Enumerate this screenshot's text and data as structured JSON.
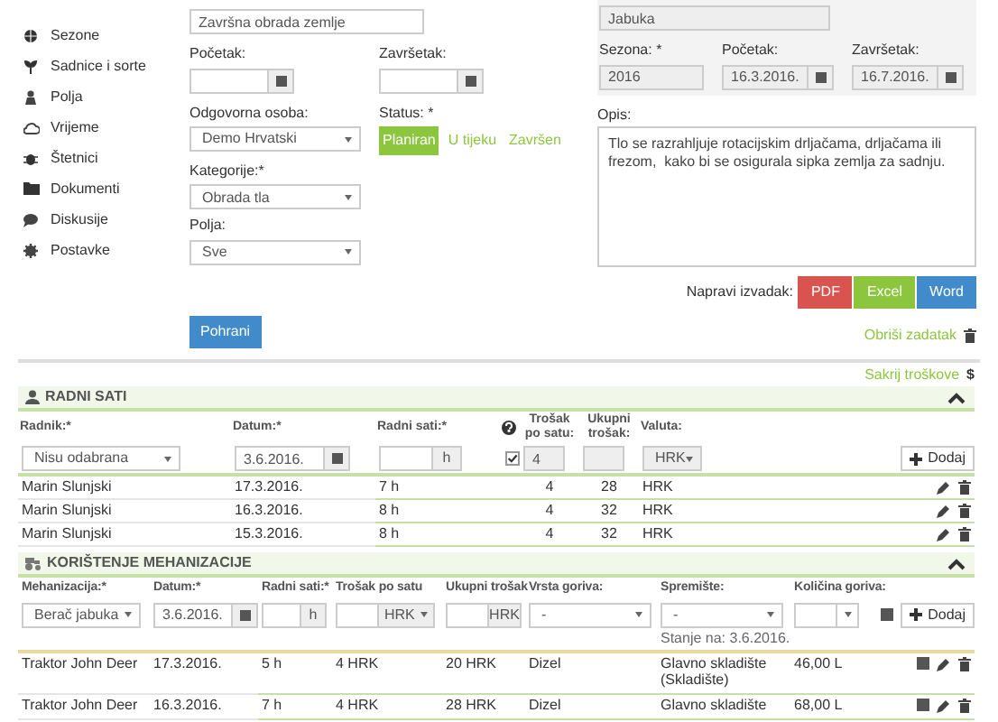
{
  "sidebar": {
    "items": [
      {
        "label": "Sezone",
        "kind": "globe"
      },
      {
        "label": "Sadnice i sorte",
        "kind": "plant"
      },
      {
        "label": "Polja",
        "kind": "person"
      },
      {
        "label": "Vrijeme",
        "kind": "cloud"
      },
      {
        "label": "Štetnici",
        "kind": "bug"
      },
      {
        "label": "Dokumenti",
        "kind": "folder"
      },
      {
        "label": "Diskusije",
        "kind": "chat"
      },
      {
        "label": "Postavke",
        "kind": "gear"
      }
    ]
  },
  "task_form": {
    "name_value": "Završna obrada zemlje",
    "start_label": "Početak:",
    "end_label": "Završetak:",
    "person_label": "Odgovorna osoba:",
    "person_value": "Demo Hrvatski",
    "status_label": "Status: *",
    "statuses": [
      {
        "label": "Planiran",
        "selected": true
      },
      {
        "label": "U tijeku",
        "selected": false
      },
      {
        "label": "Završen",
        "selected": false
      }
    ],
    "category_label": "Kategorije:*",
    "category_value": "Obrada tla",
    "fields_label": "Polja:",
    "fields_value": "Sve",
    "save_button": "Pohrani"
  },
  "culture_panel": {
    "culture_value": "Jabuka",
    "season_label": "Sezona: *",
    "season_value": "2016",
    "start_label": "Početak:",
    "start_value": "16.3.2016.",
    "end_label": "Završetak:",
    "end_value": "16.7.2016.",
    "description_label": "Opis:",
    "description_value": "Tlo se razrahljuje rotacijskim drljačama, drljačama ili frezom,  kako bi se osigurala sipka zemlja za sadnju.",
    "export_label": "Napravi izvadak:",
    "export_buttons": [
      {
        "label": "PDF",
        "color": "#d9534f"
      },
      {
        "label": "Excel",
        "color": "#8cc63f"
      },
      {
        "label": "Word",
        "color": "#428bca"
      }
    ],
    "delete_link": "Obriši zadatak"
  },
  "costs_toggle": {
    "label": "Sakrij troškove",
    "icon": "$"
  },
  "work_hours": {
    "title": "RADNI SATI",
    "columns": [
      "Radnik:*",
      "Datum:*",
      "Radni sati:*",
      "Trošak po satu:",
      "Ukupni trošak:",
      "Valuta:"
    ],
    "new_row": {
      "worker": "Nisu odabrana",
      "date": "3.6.2016.",
      "hours_unit": "h",
      "checked": true,
      "rate": "4",
      "currency": "HRK",
      "add_button": "Dodaj"
    },
    "rows": [
      {
        "worker": "Marin Slunjski",
        "date": "17.3.2016.",
        "hours": "7 h",
        "rate": "4",
        "total": "28",
        "currency": "HRK"
      },
      {
        "worker": "Marin Slunjski",
        "date": "16.3.2016.",
        "hours": "8 h",
        "rate": "4",
        "total": "32",
        "currency": "HRK"
      },
      {
        "worker": "Marin Slunjski",
        "date": "15.3.2016.",
        "hours": "8 h",
        "rate": "4",
        "total": "32",
        "currency": "HRK"
      }
    ]
  },
  "machinery": {
    "title": "KORIŠTENJE MEHANIZACIJE",
    "columns": [
      "Mehanizacija:*",
      "Datum:*",
      "Radni sati:*",
      "Trošak po satu",
      "Ukupni trošak",
      "Vrsta goriva:",
      "Spremište:",
      "Količina goriva:"
    ],
    "new_row": {
      "machine": "Berač jabuka",
      "date": "3.6.2016.",
      "hours_unit": "h",
      "rate_currency": "HRK",
      "total_currency": "HRK",
      "fuel": "-",
      "storage": "-",
      "storage_note": "Stanje na: 3.6.2016.",
      "add_button": "Dodaj"
    },
    "rows": [
      {
        "machine": "Traktor John Deer",
        "date": "17.3.2016.",
        "hours": "5 h",
        "rate": "4 HRK",
        "total": "20 HRK",
        "fuel": "Dizel",
        "storage": "Glavno skladište (Skladište)",
        "amount": "46,00 L"
      },
      {
        "machine": "Traktor John Deer",
        "date": "16.3.2016.",
        "hours": "7 h",
        "rate": "4 HRK",
        "total": "28 HRK",
        "fuel": "Dizel",
        "storage": "Glavno skladište",
        "amount": "68,00 L"
      }
    ]
  }
}
